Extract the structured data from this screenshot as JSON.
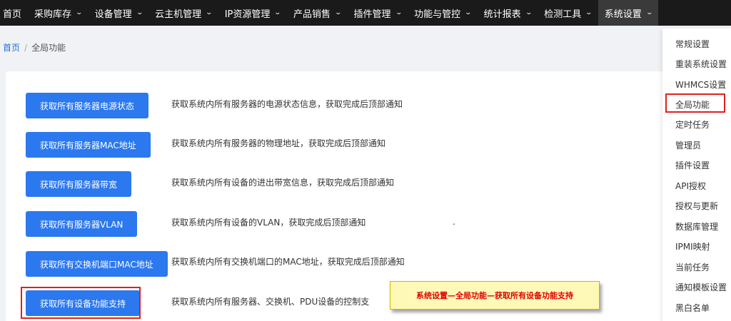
{
  "nav": {
    "items": [
      {
        "label": "首页",
        "chevron": false
      },
      {
        "label": "采购库存",
        "chevron": true
      },
      {
        "label": "设备管理",
        "chevron": true
      },
      {
        "label": "云主机管理",
        "chevron": true
      },
      {
        "label": "IP资源管理",
        "chevron": true
      },
      {
        "label": "产品销售",
        "chevron": true
      },
      {
        "label": "插件管理",
        "chevron": true
      },
      {
        "label": "功能与管控",
        "chevron": true
      },
      {
        "label": "统计报表",
        "chevron": true
      },
      {
        "label": "检测工具",
        "chevron": true
      },
      {
        "label": "系统设置",
        "chevron": true,
        "active": true
      }
    ]
  },
  "breadcrumb": {
    "home": "首页",
    "separator": "/",
    "current": "全局功能"
  },
  "functions": [
    {
      "button": "获取所有服务器电源状态",
      "desc": "获取系统内所有服务器的电源状态信息，获取完成后顶部通知"
    },
    {
      "button": "获取所有服务器MAC地址",
      "desc": "获取系统内所有服务器的物理地址，获取完成后顶部通知"
    },
    {
      "button": "获取所有服务器带宽",
      "desc": "获取系统内所有设备的进出带宽信息，获取完成后顶部通知"
    },
    {
      "button": "获取所有服务器VLAN",
      "desc": "获取系统内所有设备的VLAN，获取完成后顶部通知"
    },
    {
      "button": "获取所有交换机端口MAC地址",
      "desc": "获取系统内所有交换机端口的MAC地址，获取完成后顶部通知"
    },
    {
      "button": "获取所有设备功能支持",
      "desc": "获取系统内所有服务器、交换机、PDU设备的控制支"
    }
  ],
  "stray_mark": ".",
  "callout": {
    "text": "系统设置—全局功能—获取所有设备功能支持"
  },
  "dropdown": {
    "items": [
      "常规设置",
      "重装系统设置",
      "WHMCS设置",
      "全局功能",
      "定时任务",
      "管理员",
      "插件设置",
      "API授权",
      "授权与更新",
      "数据库管理",
      "IPMI映射",
      "当前任务",
      "通知模板设置",
      "黑白名单"
    ]
  },
  "colors": {
    "nav_bg": "#1a1a1a",
    "primary": "#2b78ef",
    "highlight": "#e02020",
    "callout_bg": "#fff9b8",
    "callout_text": "#e00000"
  }
}
